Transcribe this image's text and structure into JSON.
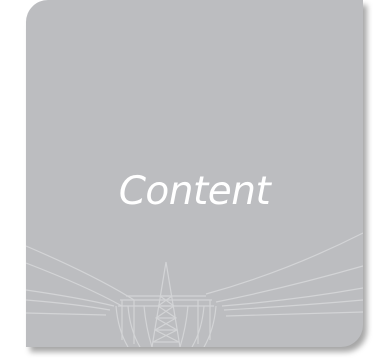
{
  "card": {
    "title": "Content",
    "background_color": "#bcbdc0",
    "title_color": "#ffffff",
    "line_art_color": "#d3d4d6",
    "illustration_icon": "power-line-tower-icon"
  }
}
